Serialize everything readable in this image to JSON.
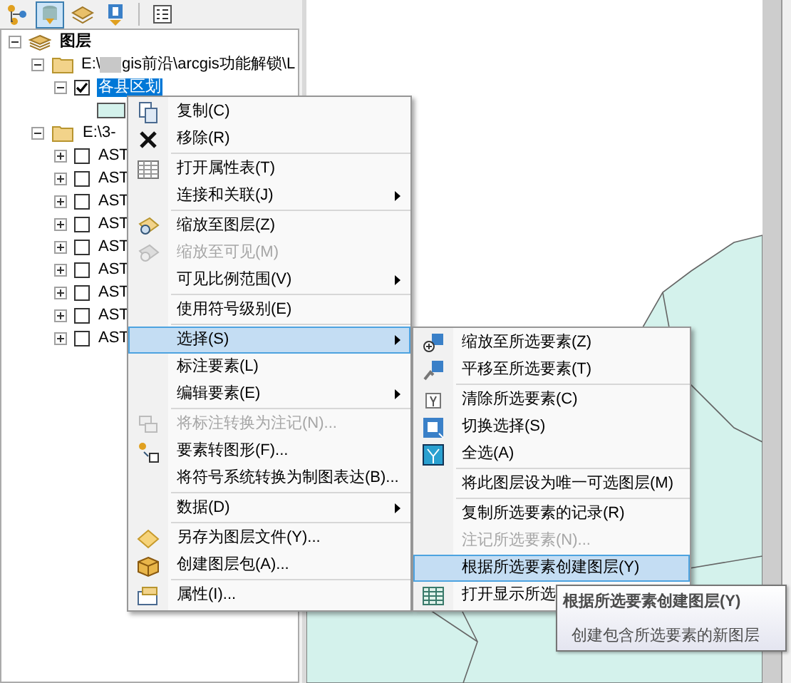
{
  "toolbar": {
    "buttons": [
      {
        "selected": false
      },
      {
        "selected": true
      },
      {
        "selected": false
      },
      {
        "selected": false
      },
      {
        "selected": false
      }
    ]
  },
  "tree": [
    {
      "kind": "root",
      "label": "图层",
      "expanded": true,
      "children": [
        {
          "kind": "group",
          "label_start": "E:\\",
          "redacted": true,
          "label": "gis前沿\\arcgis功能解锁\\L",
          "expanded": true,
          "children": [
            {
              "kind": "layer",
              "label": "各县区划",
              "checked": true,
              "selected": true,
              "expanded": true,
              "children": [
                {
                  "kind": "legend"
                }
              ]
            }
          ]
        },
        {
          "kind": "group",
          "label": "E:\\3-",
          "expanded": true,
          "children": [
            {
              "kind": "layer",
              "label": "AST",
              "checked": false,
              "selected": false,
              "expanded": false
            },
            {
              "kind": "layer",
              "label": "AST",
              "checked": false,
              "selected": false,
              "expanded": false
            },
            {
              "kind": "layer",
              "label": "AST",
              "checked": false,
              "selected": false,
              "expanded": false
            },
            {
              "kind": "layer",
              "label": "AST",
              "checked": false,
              "selected": false,
              "expanded": false
            },
            {
              "kind": "layer",
              "label": "AST",
              "checked": false,
              "selected": false,
              "expanded": false
            },
            {
              "kind": "layer",
              "label": "AST",
              "checked": false,
              "selected": false,
              "expanded": false
            },
            {
              "kind": "layer",
              "label": "AST",
              "checked": false,
              "selected": false,
              "expanded": false
            },
            {
              "kind": "layer",
              "label": "AST",
              "checked": false,
              "selected": false,
              "expanded": false
            },
            {
              "kind": "layer",
              "label": "AST",
              "checked": false,
              "selected": false,
              "expanded": false
            }
          ]
        }
      ]
    }
  ],
  "context_menu": {
    "groups": [
      [
        {
          "label": "复制(C)",
          "disabled": false,
          "submenu": false,
          "selected": false
        },
        {
          "label": "移除(R)",
          "disabled": false,
          "submenu": false,
          "selected": false
        }
      ],
      [
        {
          "label": "打开属性表(T)",
          "disabled": false,
          "submenu": false,
          "selected": false
        },
        {
          "label": "连接和关联(J)",
          "disabled": false,
          "submenu": true,
          "selected": false
        }
      ],
      [
        {
          "label": "缩放至图层(Z)",
          "disabled": false,
          "submenu": false,
          "selected": false
        },
        {
          "label": "缩放至可见(M)",
          "disabled": true,
          "submenu": false,
          "selected": false
        },
        {
          "label": "可见比例范围(V)",
          "disabled": false,
          "submenu": true,
          "selected": false
        }
      ],
      [
        {
          "label": "使用符号级别(E)",
          "disabled": false,
          "submenu": false,
          "selected": false
        }
      ],
      [
        {
          "label": "选择(S)",
          "disabled": false,
          "submenu": true,
          "selected": true
        },
        {
          "label": "标注要素(L)",
          "disabled": false,
          "submenu": false,
          "selected": false
        },
        {
          "label": "编辑要素(E)",
          "disabled": false,
          "submenu": true,
          "selected": false
        }
      ],
      [
        {
          "label": "将标注转换为注记(N)...",
          "disabled": true,
          "submenu": false,
          "selected": false
        },
        {
          "label": "要素转图形(F)...",
          "disabled": false,
          "submenu": false,
          "selected": false
        },
        {
          "label": "将符号系统转换为制图表达(B)...",
          "disabled": false,
          "submenu": false,
          "selected": false
        }
      ],
      [
        {
          "label": "数据(D)",
          "disabled": false,
          "submenu": true,
          "selected": false
        }
      ],
      [
        {
          "label": "另存为图层文件(Y)...",
          "disabled": false,
          "submenu": false,
          "selected": false
        },
        {
          "label": "创建图层包(A)...",
          "disabled": false,
          "submenu": false,
          "selected": false
        }
      ],
      [
        {
          "label": "属性(I)...",
          "disabled": false,
          "submenu": false,
          "selected": false
        }
      ]
    ]
  },
  "submenu": {
    "groups": [
      [
        {
          "label": "缩放至所选要素(Z)",
          "disabled": false,
          "selected": false
        },
        {
          "label": "平移至所选要素(T)",
          "disabled": false,
          "selected": false
        }
      ],
      [
        {
          "label": "清除所选要素(C)",
          "disabled": false,
          "selected": false
        },
        {
          "label": "切换选择(S)",
          "disabled": false,
          "selected": false
        },
        {
          "label": "全选(A)",
          "disabled": false,
          "selected": false
        }
      ],
      [
        {
          "label": "将此图层设为唯一可选图层(M)",
          "disabled": false,
          "selected": false
        }
      ],
      [
        {
          "label": "复制所选要素的记录(R)",
          "disabled": false,
          "selected": false
        },
        {
          "label": "注记所选要素(N)...",
          "disabled": true,
          "selected": false
        },
        {
          "label": "根据所选要素创建图层(Y)",
          "disabled": false,
          "selected": true
        },
        {
          "label": "打开显示所选",
          "disabled": false,
          "selected": false
        }
      ]
    ]
  },
  "tooltip": {
    "title": "根据所选要素创建图层(Y)",
    "description": "创建包含所选要素的新图层"
  }
}
